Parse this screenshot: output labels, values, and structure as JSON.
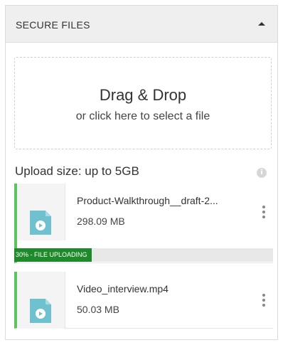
{
  "header": {
    "title": "SECURE FILES",
    "collapse_icon": "chevron-up-icon"
  },
  "dropzone": {
    "title": "Drag & Drop",
    "subtitle": "or click here to select a file"
  },
  "upload_size": {
    "label": "Upload size: up to 5GB",
    "info_icon": "info-icon",
    "info_glyph": "i"
  },
  "accent_color": "#5cc45c",
  "files": [
    {
      "name": "Product-Walkthrough__draft-2...",
      "size": "298.09 MB",
      "progress": 30,
      "progress_text": "30% - FILE UPLOADING",
      "icon": "video-file-icon"
    },
    {
      "name": "Video_interview.mp4",
      "size": "50.03 MB",
      "icon": "video-file-icon"
    }
  ]
}
